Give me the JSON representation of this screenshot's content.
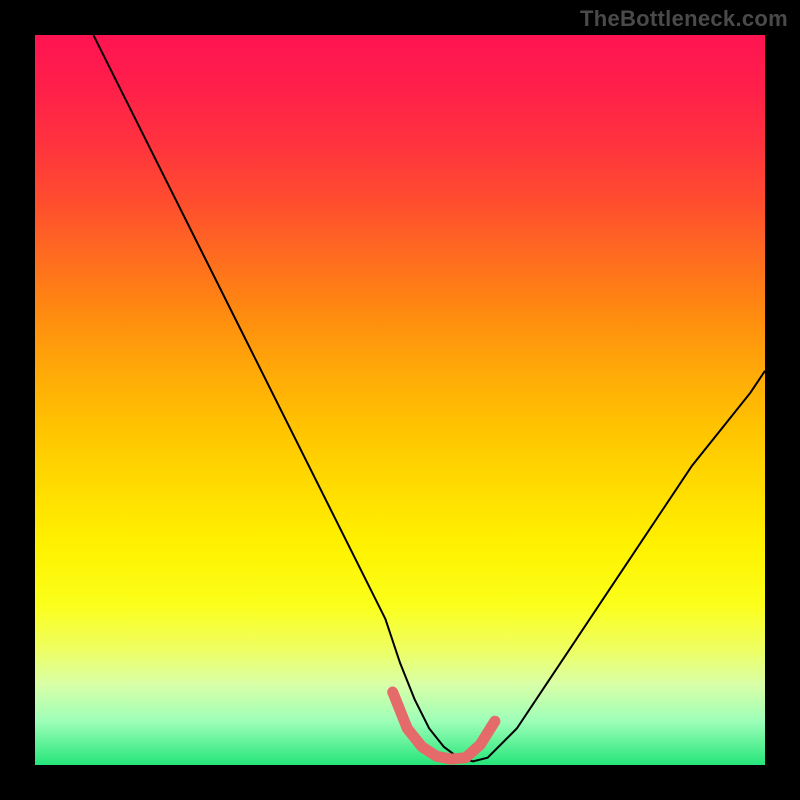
{
  "watermark": "TheBottleneck.com",
  "chart_data": {
    "type": "line",
    "title": "",
    "xlabel": "",
    "ylabel": "",
    "xlim": [
      0,
      100
    ],
    "ylim": [
      0,
      100
    ],
    "grid": false,
    "legend": false,
    "background_gradient": {
      "stops": [
        {
          "pos": 0.0,
          "color": "#ff1452"
        },
        {
          "pos": 0.3,
          "color": "#ff6a20"
        },
        {
          "pos": 0.6,
          "color": "#ffd800"
        },
        {
          "pos": 0.9,
          "color": "#e6ff90"
        },
        {
          "pos": 1.0,
          "color": "#25e57a"
        }
      ]
    },
    "series": [
      {
        "name": "curve",
        "color": "#000000",
        "stroke_width": 2,
        "x": [
          8,
          12,
          16,
          20,
          24,
          28,
          32,
          36,
          40,
          44,
          48,
          50,
          52,
          54,
          56,
          58,
          60,
          62,
          66,
          70,
          74,
          78,
          82,
          86,
          90,
          94,
          98,
          100
        ],
        "values": [
          100,
          92,
          84,
          76,
          68,
          60,
          52,
          44,
          36,
          28,
          20,
          14,
          9,
          5,
          2.5,
          1,
          0.5,
          1,
          5,
          11,
          17,
          23,
          29,
          35,
          41,
          46,
          51,
          54
        ]
      },
      {
        "name": "flat-highlight",
        "color": "#e56a6a",
        "stroke_width": 11,
        "linecap": "round",
        "x": [
          49,
          51,
          53,
          55,
          57,
          59,
          61,
          63
        ],
        "values": [
          10,
          5,
          2.5,
          1.2,
          0.8,
          1.0,
          2.8,
          6
        ]
      }
    ]
  }
}
